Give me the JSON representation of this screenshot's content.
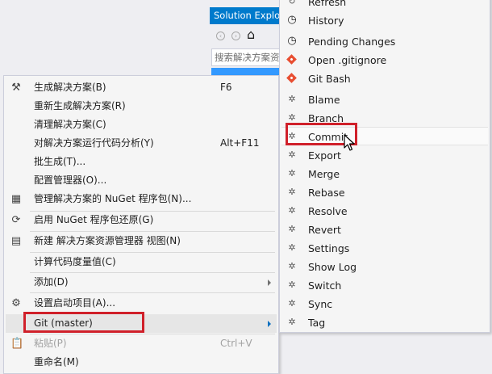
{
  "solution_explorer": {
    "title": "Solution Explo",
    "search_placeholder": "搜索解决方案资"
  },
  "context_menu": {
    "items": [
      {
        "label": "生成解决方案(B)",
        "shortcut": "F6",
        "icon": "build-solution-icon"
      },
      {
        "label": "重新生成解决方案(R)",
        "shortcut": ""
      },
      {
        "label": "清理解决方案(C)",
        "shortcut": ""
      },
      {
        "label": "对解决方案运行代码分析(Y)",
        "shortcut": "Alt+F11"
      },
      {
        "label": "批生成(T)...",
        "shortcut": ""
      },
      {
        "label": "配置管理器(O)...",
        "shortcut": ""
      },
      {
        "label": "管理解决方案的 NuGet 程序包(N)...",
        "shortcut": "",
        "icon": "nuget-package-icon"
      },
      {
        "label": "启用 NuGet 程序包还原(G)",
        "shortcut": "",
        "icon": "nuget-restore-icon"
      },
      {
        "label": "新建 解决方案资源管理器 视图(N)",
        "shortcut": "",
        "icon": "new-view-icon"
      },
      {
        "label": "计算代码度量值(C)",
        "shortcut": ""
      },
      {
        "label": "添加(D)",
        "shortcut": "",
        "submenu": true
      },
      {
        "label": "设置启动项目(A)...",
        "shortcut": "",
        "icon": "gear-icon"
      },
      {
        "label": "Git (master)",
        "shortcut": "",
        "submenu": true,
        "highlighted": true
      },
      {
        "label": "粘贴(P)",
        "shortcut": "Ctrl+V",
        "disabled": true,
        "icon": "paste-icon"
      },
      {
        "label": "重命名(M)",
        "shortcut": ""
      }
    ]
  },
  "git_submenu": {
    "items": [
      {
        "label": "Refresh",
        "icon": "refresh-icon"
      },
      {
        "label": "History",
        "icon": "history-icon"
      },
      {
        "label": "Pending Changes",
        "icon": "pending-changes-icon"
      },
      {
        "label": "Open .gitignore",
        "icon": "git-logo-icon"
      },
      {
        "label": "Git Bash",
        "icon": "git-logo-icon"
      },
      {
        "label": "Blame",
        "icon": "git-tool-icon"
      },
      {
        "label": "Branch",
        "icon": "git-tool-icon"
      },
      {
        "label": "Commit",
        "icon": "git-tool-icon",
        "highlighted": true
      },
      {
        "label": "Export",
        "icon": "git-tool-icon"
      },
      {
        "label": "Merge",
        "icon": "git-tool-icon"
      },
      {
        "label": "Rebase",
        "icon": "git-tool-icon"
      },
      {
        "label": "Resolve",
        "icon": "git-tool-icon"
      },
      {
        "label": "Revert",
        "icon": "git-tool-icon"
      },
      {
        "label": "Settings",
        "icon": "git-tool-icon"
      },
      {
        "label": "Show Log",
        "icon": "git-tool-icon"
      },
      {
        "label": "Switch",
        "icon": "git-tool-icon"
      },
      {
        "label": "Sync",
        "icon": "git-tool-icon"
      },
      {
        "label": "Tag",
        "icon": "git-tool-icon"
      }
    ]
  },
  "colors": {
    "accent": "#007acc",
    "highlight_box": "#d0202a",
    "git_logo": "#e84e31"
  }
}
